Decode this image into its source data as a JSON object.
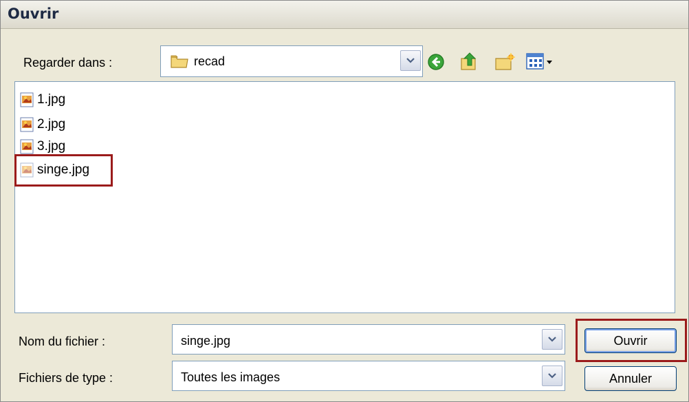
{
  "dialog": {
    "title": "Ouvrir"
  },
  "lookin": {
    "label": "Regarder dans :",
    "value": "recad",
    "folder_icon": "folder-icon"
  },
  "toolbar": {
    "icons": [
      "back-icon",
      "up-folder-icon",
      "new-folder-icon",
      "view-menu-icon"
    ]
  },
  "files": [
    {
      "name": "1.jpg",
      "icon": "image-file-icon"
    },
    {
      "name": "2.jpg",
      "icon": "image-file-icon"
    },
    {
      "name": "3.jpg",
      "icon": "image-file-icon"
    },
    {
      "name": "singe.jpg",
      "icon": "image-file-icon"
    }
  ],
  "filename": {
    "label": "Nom du fichier :",
    "value": "singe.jpg"
  },
  "filetype": {
    "label": "Fichiers de type :",
    "value": "Toutes les images"
  },
  "buttons": {
    "open": "Ouvrir",
    "cancel": "Annuler"
  },
  "colors": {
    "highlight": "#9b1b1b",
    "dialog_bg": "#ece9d8",
    "field_border": "#7f9db9"
  }
}
